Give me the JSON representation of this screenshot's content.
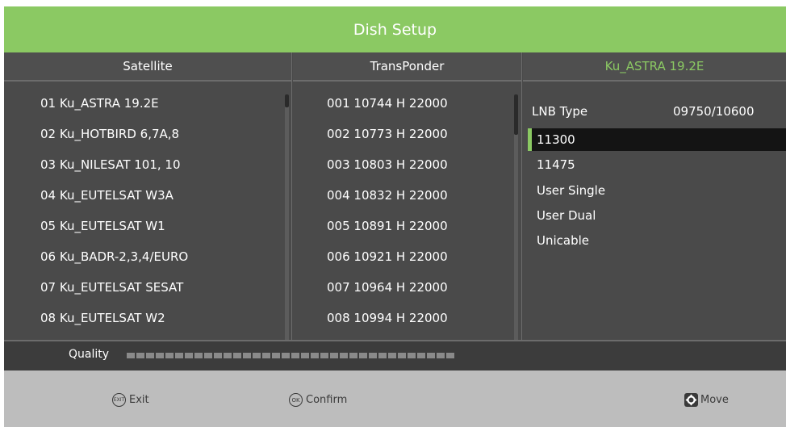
{
  "window": {
    "title": "Dish Setup"
  },
  "columns": {
    "satellite_header": "Satellite",
    "transponder_header": "TransPonder",
    "selected_satellite_header": "Ku_ASTRA 19.2E"
  },
  "satellites": [
    "01 Ku_ASTRA 19.2E",
    "02 Ku_HOTBIRD 6,7A,8",
    "03 Ku_NILESAT 101, 10",
    "04 Ku_EUTELSAT W3A",
    "05 Ku_EUTELSAT W1",
    "06 Ku_BADR-2,3,4/EURO",
    "07 Ku_EUTELSAT SESAT",
    "08 Ku_EUTELSAT W2"
  ],
  "transponders": [
    "001 10744 H 22000",
    "002 10773 H 22000",
    "003 10803 H 22000",
    "004 10832 H 22000",
    "005 10891 H 22000",
    "006 10921 H 22000",
    "007 10964 H 22000",
    "008 10994 H 22000"
  ],
  "lnb": {
    "label": "LNB Type",
    "value": "09750/10600",
    "options": [
      "11300",
      "11475",
      "User Single",
      "User Dual",
      "Unicable"
    ],
    "selected_index": 0
  },
  "quality": {
    "label": "Quality",
    "level": 0
  },
  "footer": {
    "exit_key": "EXIT",
    "exit_label": "Exit",
    "confirm_key": "OK",
    "confirm_label": "Confirm",
    "move_label": "Move"
  },
  "colors": {
    "accent": "#8bc963",
    "panel": "#4a4a4a",
    "footer": "#bdbdbd"
  }
}
